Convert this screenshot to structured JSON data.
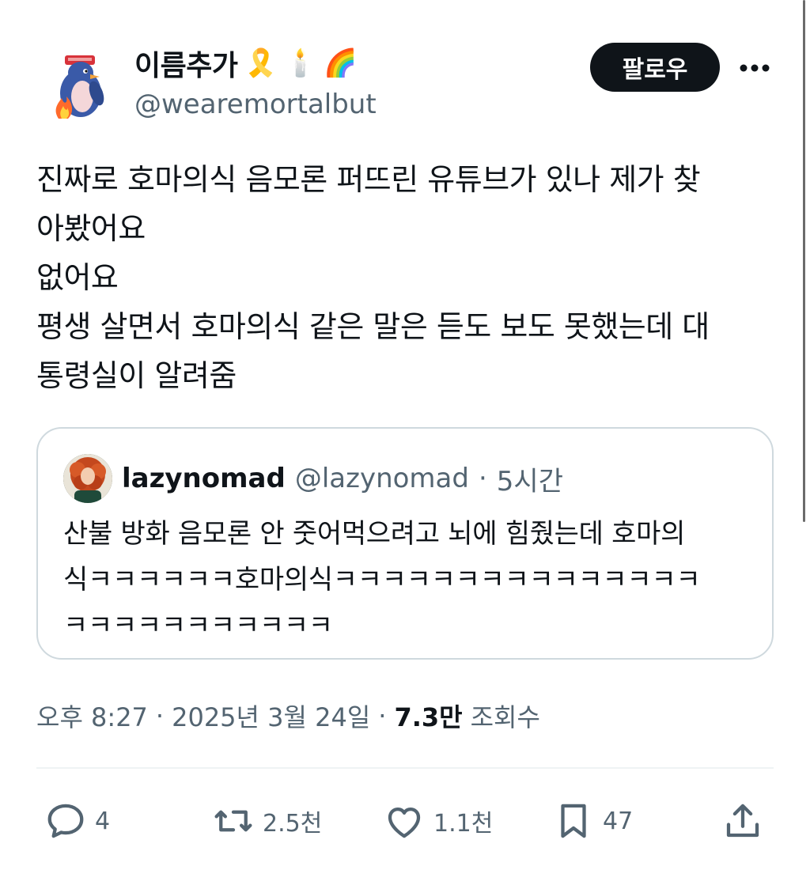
{
  "author": {
    "display_name": "이름추가",
    "emojis": [
      "🎗️",
      "🕯️",
      "🌈"
    ],
    "handle": "@wearemortalbut",
    "follow_label": "팔로우"
  },
  "tweet_lines": [
    "진짜로 호마의식 음모론 퍼뜨린 유튜브가 있나 제가 찾",
    "아봤어요",
    "없어요",
    "평생 살면서 호마의식 같은 말은 듣도 보도 못했는데 대",
    "통령실이 알려줌"
  ],
  "quote": {
    "name": "lazynomad",
    "handle": "@lazynomad",
    "separator": "·",
    "time": "5시간",
    "lines": [
      "산불 방화 음모론 안 줏어먹으려고 뇌에 힘줬는데 호마의",
      "식ㅋㅋㅋㅋㅋㅋ호마의식ㅋㅋㅋㅋㅋㅋㅋㅋㅋㅋㅋㅋㅋㅋㅋ",
      "ㅋㅋㅋㅋㅋㅋㅋㅋㅋㅋㅋ"
    ]
  },
  "meta": {
    "time": "오후 8:27",
    "sep1": "·",
    "date": "2025년 3월 24일",
    "sep2": "·",
    "views_count": "7.3만",
    "views_label": "조회수"
  },
  "actions": {
    "replies": "4",
    "reposts": "2.5천",
    "likes": "1.1천",
    "bookmarks": "47"
  },
  "icons": {
    "reply": "reply-icon",
    "repost": "repost-icon",
    "like": "heart-icon",
    "bookmark": "bookmark-icon",
    "share": "share-icon",
    "more": "more-icon"
  }
}
